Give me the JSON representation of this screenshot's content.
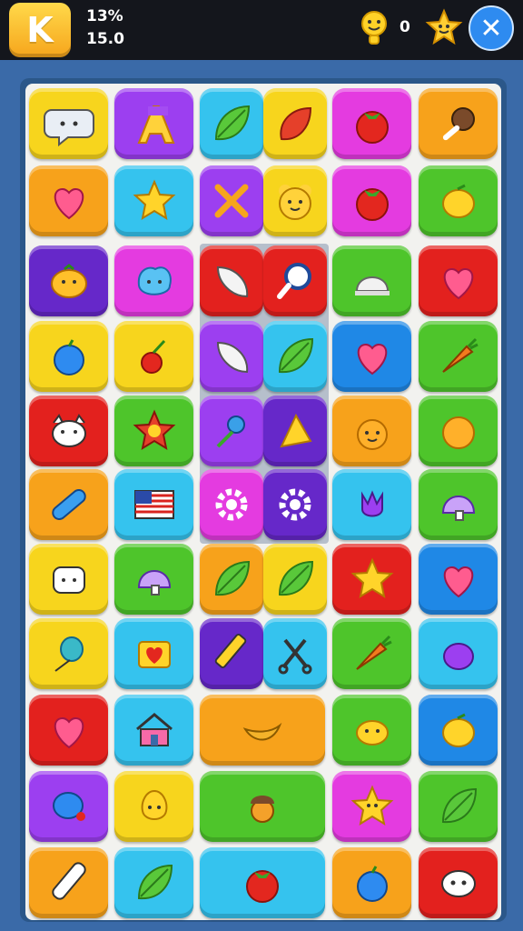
{
  "hud": {
    "logo_letter": "K",
    "percent": "13%",
    "value": "15.0",
    "coins": "0"
  },
  "colors": {
    "yellow": "#f7d51d",
    "purple": "#9c3ff0",
    "cyan": "#35c3ee",
    "green": "#4ec52b",
    "orange": "#f7a21b",
    "red": "#e3211e",
    "magenta": "#e43be0",
    "pink": "#f04f8c",
    "blue": "#1f88e6",
    "darkpurple": "#6628c9"
  },
  "tiles": [
    {
      "name": "chat-bubble-icon",
      "color": "yellow"
    },
    {
      "name": "letter-a-icon",
      "color": "purple"
    },
    {
      "name": "leaf-icon",
      "color": "cyan"
    },
    {
      "name": "red-leaf-icon",
      "color": "yellow"
    },
    {
      "name": "tomato-icon",
      "color": "magenta"
    },
    {
      "name": "lollipop-icon",
      "color": "orange"
    },
    {
      "name": "heart-icon",
      "color": "orange"
    },
    {
      "name": "star-icon",
      "color": "cyan"
    },
    {
      "name": "crossed-tools-icon",
      "color": "purple"
    },
    {
      "name": "bear-face-icon",
      "color": "yellow"
    },
    {
      "name": "tomato-icon",
      "color": "magenta"
    },
    {
      "name": "lemon-icon",
      "color": "green"
    },
    {
      "name": "pumpkin-face-icon",
      "color": "darkpurple"
    },
    {
      "name": "blue-blob-face-icon",
      "color": "magenta"
    },
    {
      "name": "feather-icon",
      "color": "red"
    },
    {
      "name": "magnifier-icon",
      "color": "red"
    },
    {
      "name": "helmet-icon",
      "color": "green"
    },
    {
      "name": "heart-icon",
      "color": "red"
    },
    {
      "name": "apple-icon",
      "color": "yellow"
    },
    {
      "name": "cherry-icon",
      "color": "yellow"
    },
    {
      "name": "feather-icon",
      "color": "purple"
    },
    {
      "name": "leaf-icon",
      "color": "cyan"
    },
    {
      "name": "heart-icon",
      "color": "blue"
    },
    {
      "name": "carrot-icon",
      "color": "green"
    },
    {
      "name": "cat-face-icon",
      "color": "red"
    },
    {
      "name": "flower-icon",
      "color": "green"
    },
    {
      "name": "rose-icon",
      "color": "purple"
    },
    {
      "name": "fan-icon",
      "color": "darkpurple"
    },
    {
      "name": "orange-face-icon",
      "color": "orange"
    },
    {
      "name": "orange-fruit-icon",
      "color": "green"
    },
    {
      "name": "bandage-icon",
      "color": "orange"
    },
    {
      "name": "flag-icon",
      "color": "cyan"
    },
    {
      "name": "gear-icon",
      "color": "magenta"
    },
    {
      "name": "gear-icon",
      "color": "darkpurple"
    },
    {
      "name": "tulip-icon",
      "color": "cyan"
    },
    {
      "name": "mushroom-icon",
      "color": "green"
    },
    {
      "name": "marshmallow-icon",
      "color": "yellow"
    },
    {
      "name": "mushroom-icon",
      "color": "green"
    },
    {
      "name": "leaf-icon",
      "color": "orange"
    },
    {
      "name": "leaf-icon",
      "color": "yellow"
    },
    {
      "name": "star-icon",
      "color": "red"
    },
    {
      "name": "heart-icon",
      "color": "blue"
    },
    {
      "name": "balloon-icon",
      "color": "yellow"
    },
    {
      "name": "heart-box-icon",
      "color": "cyan"
    },
    {
      "name": "pencil-icon",
      "color": "darkpurple"
    },
    {
      "name": "scissors-icon",
      "color": "cyan"
    },
    {
      "name": "carrot-icon",
      "color": "green"
    },
    {
      "name": "plum-icon",
      "color": "cyan"
    },
    {
      "name": "heart-icon",
      "color": "red"
    },
    {
      "name": "house-icon",
      "color": "cyan"
    },
    {
      "name": "bananas-icon",
      "color": "orange"
    },
    {
      "name": "lemon-face-icon",
      "color": "green"
    },
    {
      "name": "lemon-icon",
      "color": "blue"
    },
    {
      "name": "blue-fruit-icon",
      "color": "purple"
    },
    {
      "name": "pear-face-icon",
      "color": "yellow"
    },
    {
      "name": "acorn-icon",
      "color": "green"
    },
    {
      "name": "star-face-icon",
      "color": "magenta"
    },
    {
      "name": "leaf-icon",
      "color": "green"
    },
    {
      "name": "candy-cane-icon",
      "color": "orange"
    },
    {
      "name": "leaf-icon",
      "color": "cyan"
    },
    {
      "name": "tomato-icon",
      "color": "cyan"
    },
    {
      "name": "apple-icon",
      "color": "orange"
    },
    {
      "name": "ghost-face-icon",
      "color": "red"
    }
  ]
}
